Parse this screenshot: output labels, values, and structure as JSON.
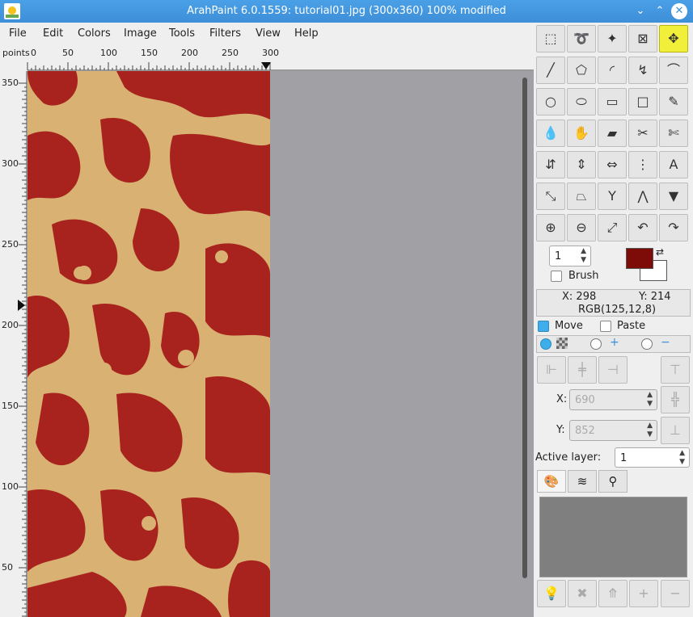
{
  "window": {
    "title": "ArahPaint 6.0.1559: tutorial01.jpg (300x360) 100% modified",
    "minimize": "⌄",
    "maximize": "⌃",
    "close": "✕"
  },
  "menu": [
    "File",
    "Edit",
    "Colors",
    "Image",
    "Tools",
    "Filters",
    "View",
    "Help"
  ],
  "ruler_top": {
    "units": "points",
    "labels": [
      "0",
      "50",
      "100",
      "150",
      "200",
      "250",
      "300"
    ]
  },
  "ruler_left": {
    "labels": [
      "350",
      "300",
      "250",
      "200",
      "150",
      "100",
      "50"
    ]
  },
  "tools": [
    {
      "icon": "⬚",
      "name": "rect-select-icon"
    },
    {
      "icon": "➰",
      "name": "lasso-icon"
    },
    {
      "icon": "✦",
      "name": "magic-wand-icon"
    },
    {
      "icon": "⊠",
      "name": "crop-icon"
    },
    {
      "icon": "✥",
      "name": "move-icon"
    },
    {
      "icon": "╱",
      "name": "line-icon"
    },
    {
      "icon": "⬠",
      "name": "polygon-icon"
    },
    {
      "icon": "◜",
      "name": "arc-icon"
    },
    {
      "icon": "↯",
      "name": "curve-icon"
    },
    {
      "icon": "⌒",
      "name": "bezier-icon"
    },
    {
      "icon": "○",
      "name": "circle-icon"
    },
    {
      "icon": "⬭",
      "name": "ellipse-icon"
    },
    {
      "icon": "▭",
      "name": "rectangle-icon"
    },
    {
      "icon": "□",
      "name": "square-icon"
    },
    {
      "icon": "✎",
      "name": "pencil-icon"
    },
    {
      "icon": "💧",
      "name": "eyedropper-icon"
    },
    {
      "icon": "✋",
      "name": "smudge-icon"
    },
    {
      "icon": "▰",
      "name": "eraser-icon"
    },
    {
      "icon": "✂",
      "name": "cut-icon"
    },
    {
      "icon": "✄",
      "name": "scissors-icon"
    },
    {
      "icon": "⇵",
      "name": "transform-icon"
    },
    {
      "icon": "⇕",
      "name": "flip-vertical-icon"
    },
    {
      "icon": "⇔",
      "name": "flip-horizontal-icon"
    },
    {
      "icon": "⋮",
      "name": "mirror-icon"
    },
    {
      "icon": "A",
      "name": "text-icon"
    },
    {
      "icon": "⤡",
      "name": "scale-icon"
    },
    {
      "icon": "⏢",
      "name": "perspective-icon"
    },
    {
      "icon": "Y",
      "name": "symmetry-icon"
    },
    {
      "icon": "⋀",
      "name": "compass-icon"
    },
    {
      "icon": "▼",
      "name": "fill-bucket-icon"
    },
    {
      "icon": "⊕",
      "name": "zoom-in-icon"
    },
    {
      "icon": "⊖",
      "name": "zoom-out-icon"
    },
    {
      "icon": "⤢",
      "name": "zoom-fit-icon"
    },
    {
      "icon": "↶",
      "name": "undo-icon"
    },
    {
      "icon": "↷",
      "name": "redo-icon"
    }
  ],
  "brush": {
    "size": "1",
    "label": "Brush"
  },
  "colors": {
    "foreground": "#7d0c08",
    "background": "#ffffff"
  },
  "info": {
    "x": "X: 298",
    "y": "Y: 214",
    "rgb": "RGB(125,12,8)"
  },
  "options": {
    "move": "Move",
    "paste": "Paste"
  },
  "position": {
    "x_label": "X:",
    "x_value": "690",
    "y_label": "Y:",
    "y_value": "852"
  },
  "layer": {
    "label": "Active layer:",
    "value": "1"
  }
}
